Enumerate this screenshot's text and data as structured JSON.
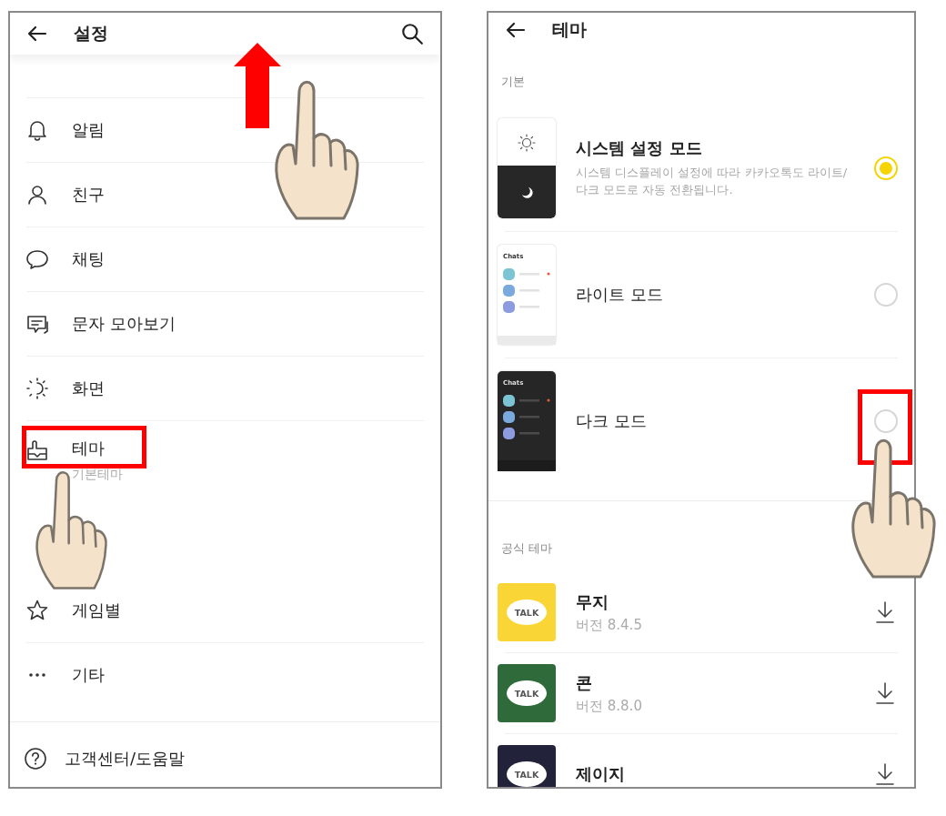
{
  "left_screen": {
    "title": "설정",
    "menu": [
      {
        "kind": "bell",
        "label": "알림",
        "highlighted": false
      },
      {
        "kind": "person",
        "label": "친구",
        "highlighted": false
      },
      {
        "kind": "bubble",
        "label": "채팅",
        "highlighted": false
      },
      {
        "kind": "sms",
        "label": "문자 모아보기",
        "highlighted": false
      },
      {
        "kind": "display",
        "label": "화면",
        "highlighted": false
      },
      {
        "kind": "theme",
        "label": "테마",
        "subtitle": "기본테마",
        "highlighted": true
      },
      {
        "kind": "star",
        "label": "게임별",
        "highlighted": false
      },
      {
        "kind": "more",
        "label": "기타",
        "highlighted": false
      }
    ],
    "footer": {
      "label": "고객센터/도움말"
    }
  },
  "right_screen": {
    "title": "테마",
    "section_basic": "기본",
    "modes": [
      {
        "kind": "system",
        "title": "시스템 설정 모드",
        "description": "시스템 디스플레이 설정에 따라 카카오톡도 라이트/다크 모드로 자동 전환됩니다.",
        "selected": true,
        "highlighted": false
      },
      {
        "kind": "light",
        "title": "라이트 모드",
        "preview_label": "Chats",
        "selected": false,
        "highlighted": false
      },
      {
        "kind": "dark",
        "title": "다크 모드",
        "preview_label": "Chats",
        "selected": false,
        "highlighted": true
      }
    ],
    "section_official": "공식 테마",
    "themes": [
      {
        "name": "무지",
        "version": "버전 8.4.5",
        "color": "#f9d535",
        "badge": "TALK"
      },
      {
        "name": "콘",
        "version": "버전 8.8.0",
        "color": "#2f6b3a",
        "badge": "TALK"
      },
      {
        "name": "제이지",
        "color": "#22233a",
        "badge": "TALK"
      }
    ]
  }
}
